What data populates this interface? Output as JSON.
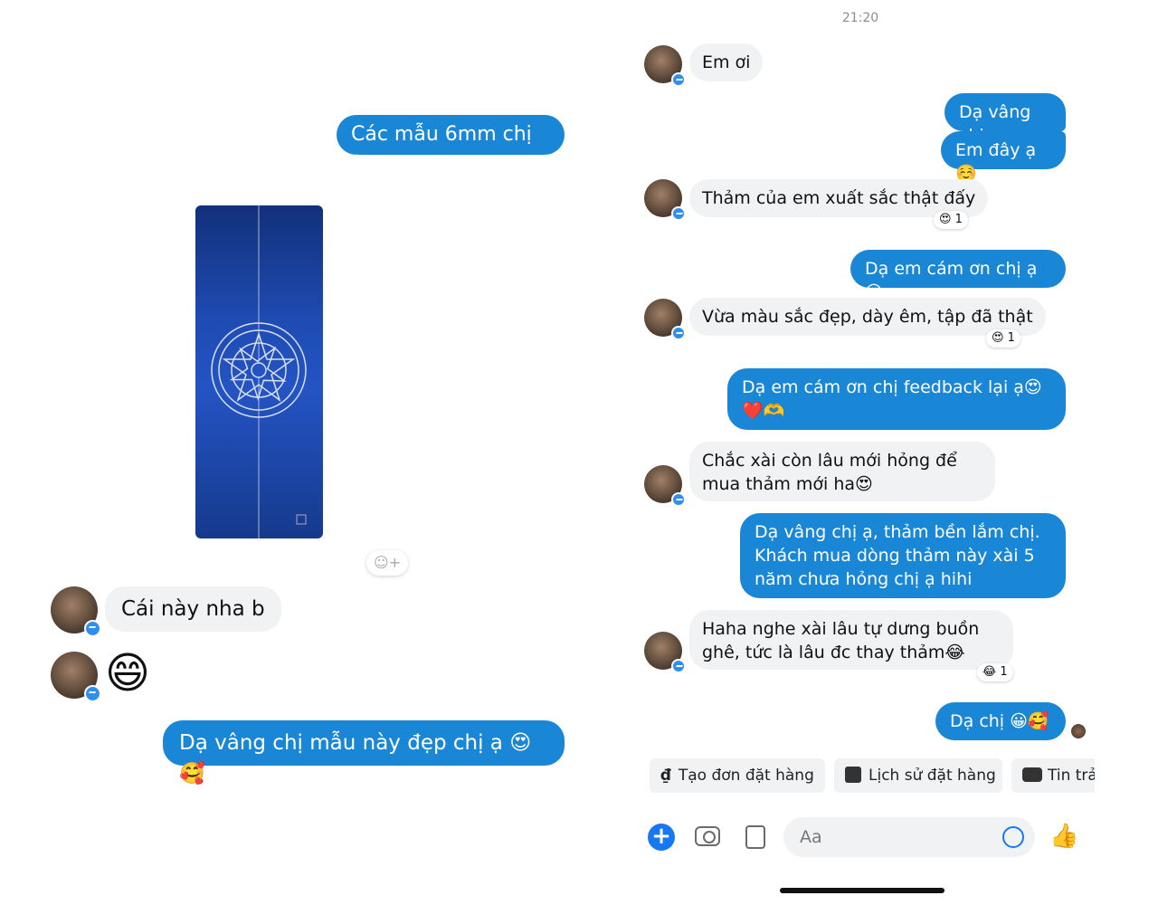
{
  "left": {
    "caption": "Các mẫu 6mm chị ạ",
    "msg_in": "Cái này nha b",
    "emoji_in": "😄",
    "msg_out": "Dạ vâng chị mẫu này đẹp chị ạ 😍🥰"
  },
  "right": {
    "timestamp": "21:20",
    "messages": [
      {
        "text": "Em ơi"
      },
      {
        "text": "Dạ vâng chị"
      },
      {
        "text": "Em đây ạ☺️"
      },
      {
        "text": "Thảm của em xuất sắc thật đấy",
        "reaction": "😍 1"
      },
      {
        "text": "Dạ em cám ơn chị ạ 😍"
      },
      {
        "text": "Vừa màu sắc đẹp, dày êm, tập đã thật",
        "reaction": "😍 1"
      },
      {
        "text": "Dạ em cám ơn chị feedback lại ạ😍❤️🫶"
      },
      {
        "text": "Chắc xài còn lâu mới hỏng để mua thảm mới ha😍"
      },
      {
        "text": "Dạ vâng chị ạ, thảm bền lắm chị. Khách mua dòng thảm này xài 5 năm chưa hỏng chị ạ hihi"
      },
      {
        "text": "Haha nghe xài lâu tự dưng buồn ghê, tức là lâu đc thay thảm😂",
        "reaction": "😂 1"
      },
      {
        "text": "Dạ chị 😀🥰"
      }
    ],
    "quick_replies": [
      "Tạo đơn đặt hàng",
      "Lịch sử đặt hàng",
      "Tin trả"
    ],
    "composer": {
      "placeholder": "Aa"
    }
  },
  "colors": {
    "outgoing": "#1a86d6",
    "incoming": "#f1f2f4",
    "accent": "#2f8ff0"
  }
}
